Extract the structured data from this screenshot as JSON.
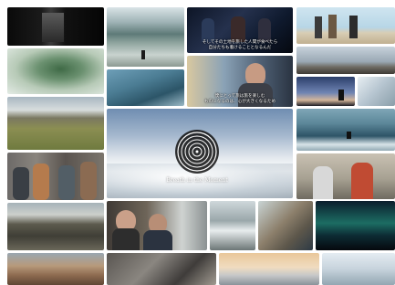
{
  "title": "Breath in the Moment",
  "subtitles": {
    "interview_top": {
      "line1": "そしてその土地を旅した人間が食べたら",
      "line2": "自分たちも着けることとなるんだ"
    },
    "interview_mid": {
      "line1": "僕にとって旅は旅を楽しむ",
      "line2": "ものになるのは、心が大きくなるため"
    }
  }
}
